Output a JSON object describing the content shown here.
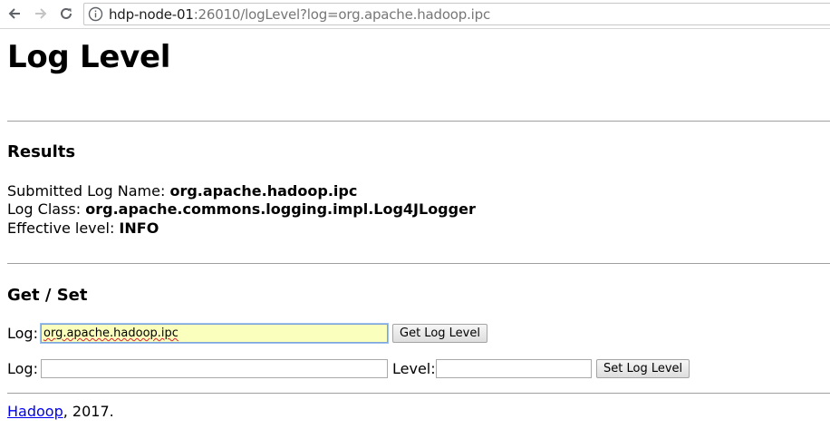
{
  "browser": {
    "url_host": "hdp-node-01",
    "url_rest": ":26010/logLevel?log=org.apache.hadoop.ipc"
  },
  "page": {
    "title": "Log Level",
    "results_heading": "Results",
    "submitted_label": "Submitted Log Name: ",
    "submitted_value": "org.apache.hadoop.ipc",
    "class_label": "Log Class: ",
    "class_value": "org.apache.commons.logging.impl.Log4JLogger",
    "effective_label": "Effective level: ",
    "effective_value": "INFO",
    "getset_heading": "Get / Set",
    "get_form": {
      "log_label": "Log:",
      "log_value": "org.apache.hadoop.ipc",
      "button": "Get Log Level"
    },
    "set_form": {
      "log_label": "Log:",
      "log_value": "",
      "level_label": "Level:",
      "level_value": "",
      "button": "Set Log Level"
    },
    "footer_link": "Hadoop",
    "footer_text": ", 2017."
  }
}
